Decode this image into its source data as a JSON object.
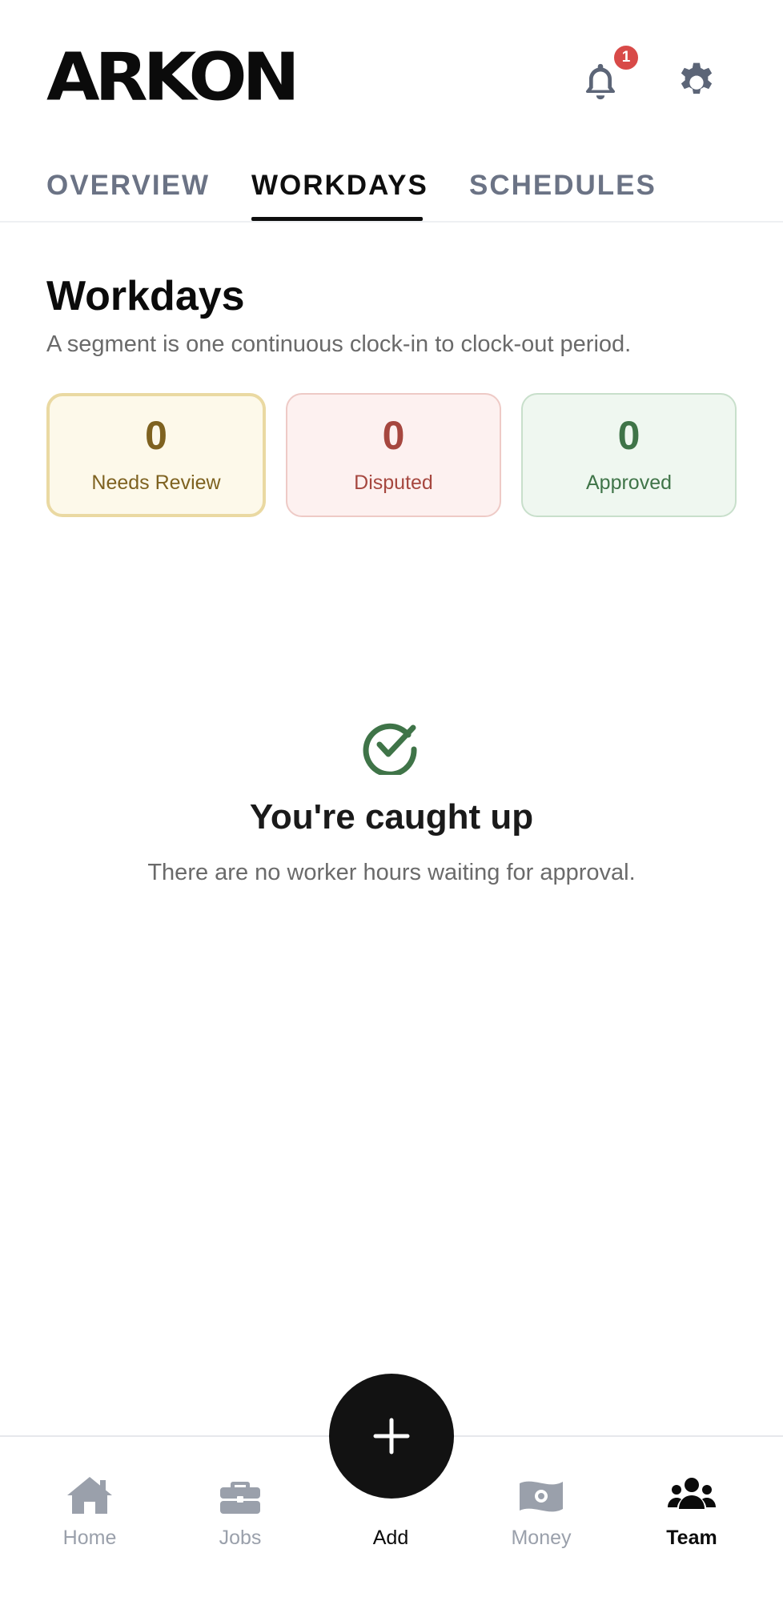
{
  "header": {
    "logo": "ARKON",
    "notification_count": "1",
    "bell_icon": "bell-icon",
    "settings_icon": "gear-icon"
  },
  "tabs": [
    {
      "label": "OVERVIEW",
      "active": false
    },
    {
      "label": "WORKDAYS",
      "active": true
    },
    {
      "label": "SCHEDULES",
      "active": false
    }
  ],
  "section": {
    "title": "Workdays",
    "subtitle": "A segment is one continuous clock-in to clock-out period."
  },
  "stats": [
    {
      "value": "0",
      "label": "Needs Review",
      "color": "#7e6220"
    },
    {
      "value": "0",
      "label": "Disputed",
      "color": "#a6473f"
    },
    {
      "value": "0",
      "label": "Approved",
      "color": "#3f7448"
    }
  ],
  "empty_state": {
    "icon": "check-circle-icon",
    "title": "You're caught up",
    "text": "There are no worker hours waiting for approval."
  },
  "bottom_nav": {
    "items": [
      {
        "label": "Home",
        "icon": "home-icon",
        "active": false
      },
      {
        "label": "Jobs",
        "icon": "briefcase-icon",
        "active": false
      },
      {
        "label": "Add",
        "icon": "plus-icon",
        "active": false
      },
      {
        "label": "Money",
        "icon": "money-icon",
        "active": false
      },
      {
        "label": "Team",
        "icon": "users-icon",
        "active": true
      }
    ]
  },
  "colors": {
    "accent": "#0b0b0b",
    "badge": "#d84a48",
    "inactive_tab": "#6b7385",
    "inactive_nav": "#9aa0ab",
    "success": "#3f7448"
  }
}
